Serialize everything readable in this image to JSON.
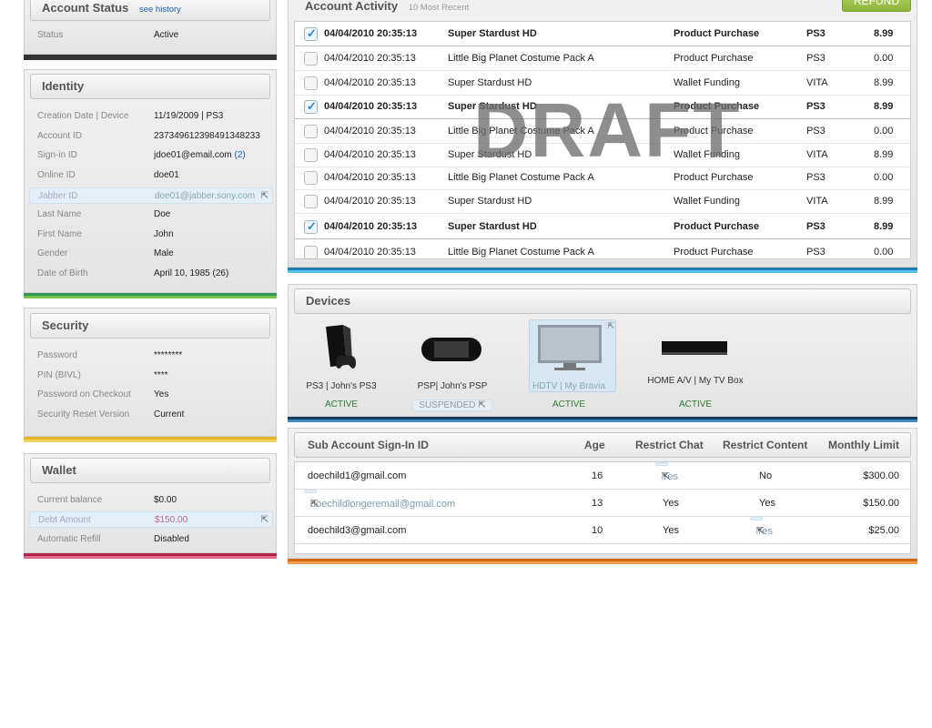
{
  "account_status": {
    "title": "Account Status",
    "link": "see history",
    "label": "Status",
    "value": "Active"
  },
  "identity": {
    "title": "Identity",
    "fields": [
      {
        "label": "Creation Date | Device",
        "value": "11/19/2009 | PS3"
      },
      {
        "label": "Account ID",
        "value": "237349612398491348233"
      },
      {
        "label": "Sign-in ID",
        "value": "jdoe01@email.com",
        "count": "(2)"
      },
      {
        "label": "Online ID",
        "value": "doe01"
      },
      {
        "label": "Jabber ID",
        "value": "doe01@jabber.sony.com"
      },
      {
        "label": "Last Name",
        "value": "Doe"
      },
      {
        "label": "First Name",
        "value": "John"
      },
      {
        "label": "Gender",
        "value": "Male"
      },
      {
        "label": "Date of Birth",
        "value": "April 10, 1985 (26)"
      }
    ]
  },
  "security": {
    "title": "Security",
    "fields": [
      {
        "label": "Password",
        "value": "********"
      },
      {
        "label": "PIN (BIVL)",
        "value": "****"
      },
      {
        "label": "Password on Checkout",
        "value": "Yes"
      },
      {
        "label": "Security Reset Version",
        "value": "Current"
      }
    ]
  },
  "wallet": {
    "title": "Wallet",
    "fields": [
      {
        "label": "Current balance",
        "value": "$0.00"
      },
      {
        "label": "Debt Amount",
        "value": "$150.00"
      },
      {
        "label": "Automatic Refill",
        "value": "Disabled"
      }
    ]
  },
  "activity": {
    "title": "Account Activity",
    "subtitle": "10 Most Recent",
    "refund": "REFUND",
    "watermark": "DRAFT",
    "rows": [
      {
        "date": "04/04/2010 20:35:13",
        "item": "Super Stardust HD",
        "type": "Product Purchase",
        "platform": "PS3",
        "amount": "8.99"
      },
      {
        "date": "04/04/2010 20:35:13",
        "item": "Little Big Planet Costume Pack A",
        "type": "Product Purchase",
        "platform": "PS3",
        "amount": "0.00"
      },
      {
        "date": "04/04/2010 20:35:13",
        "item": "Super Stardust HD",
        "type": "Wallet Funding",
        "platform": "VITA",
        "amount": "8.99"
      },
      {
        "date": "04/04/2010 20:35:13",
        "item": "Super Stardust HD",
        "type": "Product Purchase",
        "platform": "PS3",
        "amount": "8.99"
      },
      {
        "date": "04/04/2010 20:35:13",
        "item": "Little Big Planet Costume Pack A",
        "type": "Product Purchase",
        "platform": "PS3",
        "amount": "0.00"
      },
      {
        "date": "04/04/2010 20:35:13",
        "item": "Super Stardust HD",
        "type": "Wallet Funding",
        "platform": "VITA",
        "amount": "8.99"
      },
      {
        "date": "04/04/2010 20:35:13",
        "item": "Little Big Planet Costume Pack A",
        "type": "Product Purchase",
        "platform": "PS3",
        "amount": "0.00"
      },
      {
        "date": "04/04/2010 20:35:13",
        "item": "Super Stardust HD",
        "type": "Wallet Funding",
        "platform": "VITA",
        "amount": "8.99"
      },
      {
        "date": "04/04/2010 20:35:13",
        "item": "Super Stardust HD",
        "type": "Product Purchase",
        "platform": "PS3",
        "amount": "8.99"
      },
      {
        "date": "04/04/2010 20:35:13",
        "item": "Little Big Planet Costume Pack A",
        "type": "Product Purchase",
        "platform": "PS3",
        "amount": "0.00"
      }
    ]
  },
  "devices": {
    "title": "Devices",
    "items": [
      {
        "name": "PS3 | John's PS3",
        "status": "ACTIVE",
        "icon": "ps3-console-icon"
      },
      {
        "name": "PSP| John's PSP",
        "status": "SUSPENDED",
        "icon": "psp-handheld-icon"
      },
      {
        "name": "HDTV | My Bravia",
        "status": "ACTIVE",
        "icon": "tv-icon"
      },
      {
        "name": "HOME A/V | My TV Box",
        "status": "ACTIVE",
        "icon": "settop-box-icon"
      }
    ]
  },
  "subaccounts": {
    "headers": [
      "Sub Account Sign-In ID",
      "Age",
      "Restrict Chat",
      "Restrict Content",
      "Monthly Limit"
    ],
    "rows": [
      {
        "id": "doechild1@gmail.com",
        "age": "16",
        "chat": "Yes",
        "content": "No",
        "limit": "$300.00"
      },
      {
        "id": "doechildlongeremail@gmail.com",
        "age": "13",
        "chat": "Yes",
        "content": "Yes",
        "limit": "$150.00"
      },
      {
        "id": "doechild3@gmail.com",
        "age": "10",
        "chat": "Yes",
        "content": "Yes",
        "limit": "$25.00"
      }
    ]
  },
  "colors": {
    "status": "#333333",
    "identity": "#2b9a5c",
    "security": "#e2b32a",
    "wallet": "#b3224a",
    "activity": "#2a8fc6",
    "devices": "#1d5f86",
    "sub": "#e07a1a"
  }
}
